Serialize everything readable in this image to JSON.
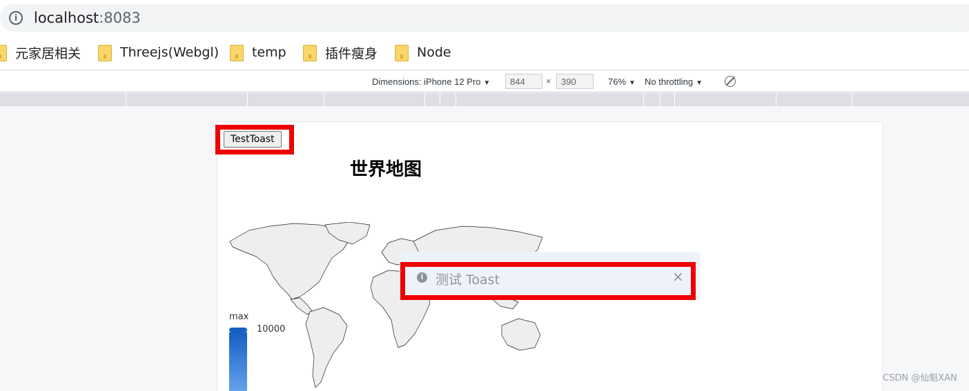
{
  "browser": {
    "url_host": "localhost",
    "url_port": ":8083",
    "bookmarks": [
      {
        "label": "元家居相关"
      },
      {
        "label": "Threejs(Webgl)"
      },
      {
        "label": "temp"
      },
      {
        "label": "插件瘦身"
      },
      {
        "label": "Node"
      }
    ]
  },
  "devtools": {
    "dimensions_label": "Dimensions: iPhone 12 Pro",
    "width": "844",
    "times": "×",
    "height": "390",
    "zoom": "76%",
    "throttling": "No throttling",
    "caret": "▼"
  },
  "page": {
    "button_label": "TestToast",
    "map_title": "世界地图",
    "visualmap": {
      "max_label": "max",
      "max_value": "10000"
    },
    "toast": {
      "message": "测试 Toast",
      "close": "×",
      "icon": "i"
    }
  },
  "watermark": "CSDN @仙魁XAN",
  "colors": {
    "accent": "#1461c2",
    "annotation": "#ee0000",
    "toast_bg": "#eef2fb",
    "land": "#eeeeee"
  }
}
